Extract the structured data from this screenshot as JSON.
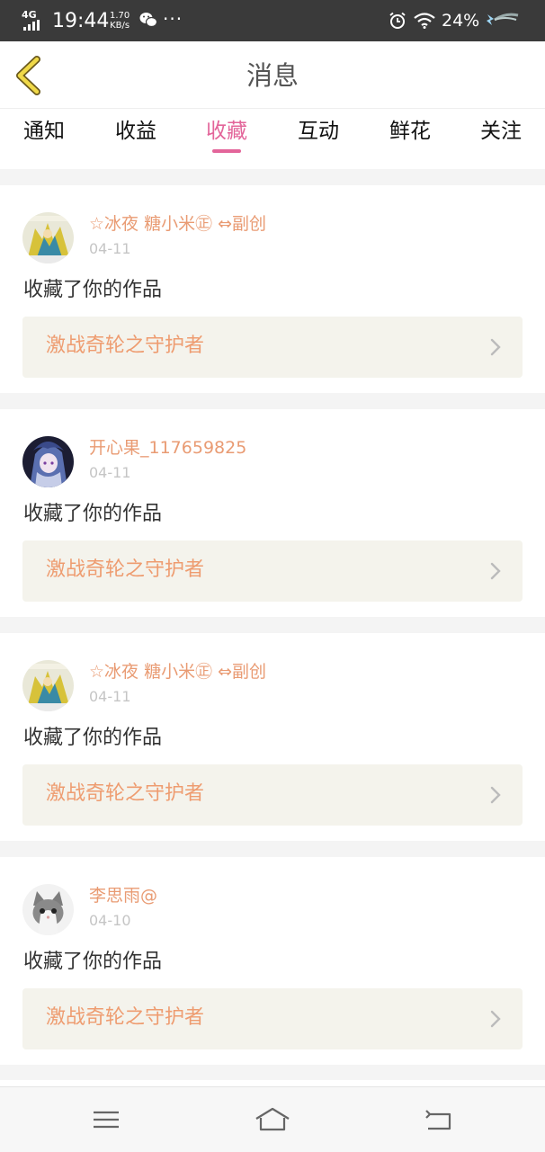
{
  "status_bar": {
    "network": "4G",
    "time": "19:44",
    "speed_value": "1.70",
    "speed_unit": "KB/s",
    "dots": "···",
    "battery": "24%"
  },
  "header": {
    "title": "消息"
  },
  "tabs": [
    {
      "label": "通知"
    },
    {
      "label": "收益"
    },
    {
      "label": "收藏"
    },
    {
      "label": "互动"
    },
    {
      "label": "鲜花"
    },
    {
      "label": "关注"
    }
  ],
  "active_tab": "收藏",
  "colors": {
    "accent": "#e3659a",
    "username": "#e99b73",
    "work_title": "#ee9c70",
    "work_box_bg": "#f4f3ec"
  },
  "messages": [
    {
      "username": "☆冰夜 糖小米㊣ ⇔副创",
      "time": "04-11",
      "action": "收藏了你的作品",
      "work": "激战奇轮之守护者",
      "avatar": "anime-game-avatar"
    },
    {
      "username": "开心果_117659825",
      "time": "04-11",
      "action": "收藏了你的作品",
      "work": "激战奇轮之守护者",
      "avatar": "anime-character-avatar"
    },
    {
      "username": "☆冰夜 糖小米㊣ ⇔副创",
      "time": "04-11",
      "action": "收藏了你的作品",
      "work": "激战奇轮之守护者",
      "avatar": "anime-game-avatar"
    },
    {
      "username": "李思雨@",
      "time": "04-10",
      "action": "收藏了你的作品",
      "work": "激战奇轮之守护者",
      "avatar": "kitten-avatar"
    }
  ]
}
